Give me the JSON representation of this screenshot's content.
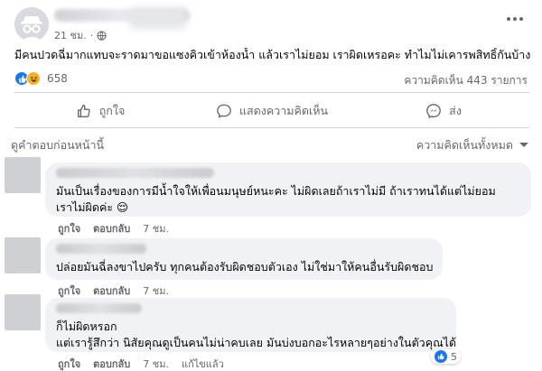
{
  "post": {
    "time": "21 ชม.",
    "separator": "·",
    "text": "มีคนปวดฉี่มากแทบจะราดมาขอแซงคิวเข้าห้องน้ำ แล้วเราไม่ยอม เราผิดเหรอคะ ทำไมไม่เคารพสิทธิ์กันบ้าง",
    "reaction_count": "658",
    "comment_count": "ความคิดเห็น 443 รายการ"
  },
  "actions": {
    "like": "ถูกใจ",
    "comment": "แสดงความคิดเห็น",
    "share": "ส่ง"
  },
  "filter": {
    "previous": "ดูคำตอบก่อนหน้านี้",
    "sort": "ความคิดเห็นทั้งหมด"
  },
  "comments": [
    {
      "lines": [
        "มันเป็นเรื่องของการมีน้ำใจให้เพื่อนมนุษย์หนะคะ ไม่ผิดเลยถ้าเราไม่มี ถ้าเราทนได้แต่ไม่ยอม",
        "เราไม่ผิดค่ะ 😌"
      ],
      "like": "ถูกใจ",
      "reply": "ตอบกลับ",
      "time": "7 ชม."
    },
    {
      "lines": [
        "ปล่อยมันฉี่ลงขาไปครับ ทุกคนต้องรับผิดชอบตัวเอง ไม่ใช่มาให้คนอื่นรับผิดชอบ"
      ],
      "like": "ถูกใจ",
      "reply": "ตอบกลับ",
      "time": "7 ชม."
    },
    {
      "lines": [
        "ก็ไม่ผิดหรอก",
        "แต่เรารู้สึกว่า นิสัยคุณดูเป็นคนไม่น่าคบเลย มันบ่งบอกอะไรหลายๆอย่างในตัวคุณได้"
      ],
      "like": "ถูกใจ",
      "reply": "ตอบกลับ",
      "time": "7 ชม.",
      "edited": "แก้ไขแล้ว",
      "reaction_count": "5"
    }
  ],
  "colors": {
    "accent": "#1877f2",
    "muted": "#65676b",
    "bubble": "#f0f2f5"
  }
}
